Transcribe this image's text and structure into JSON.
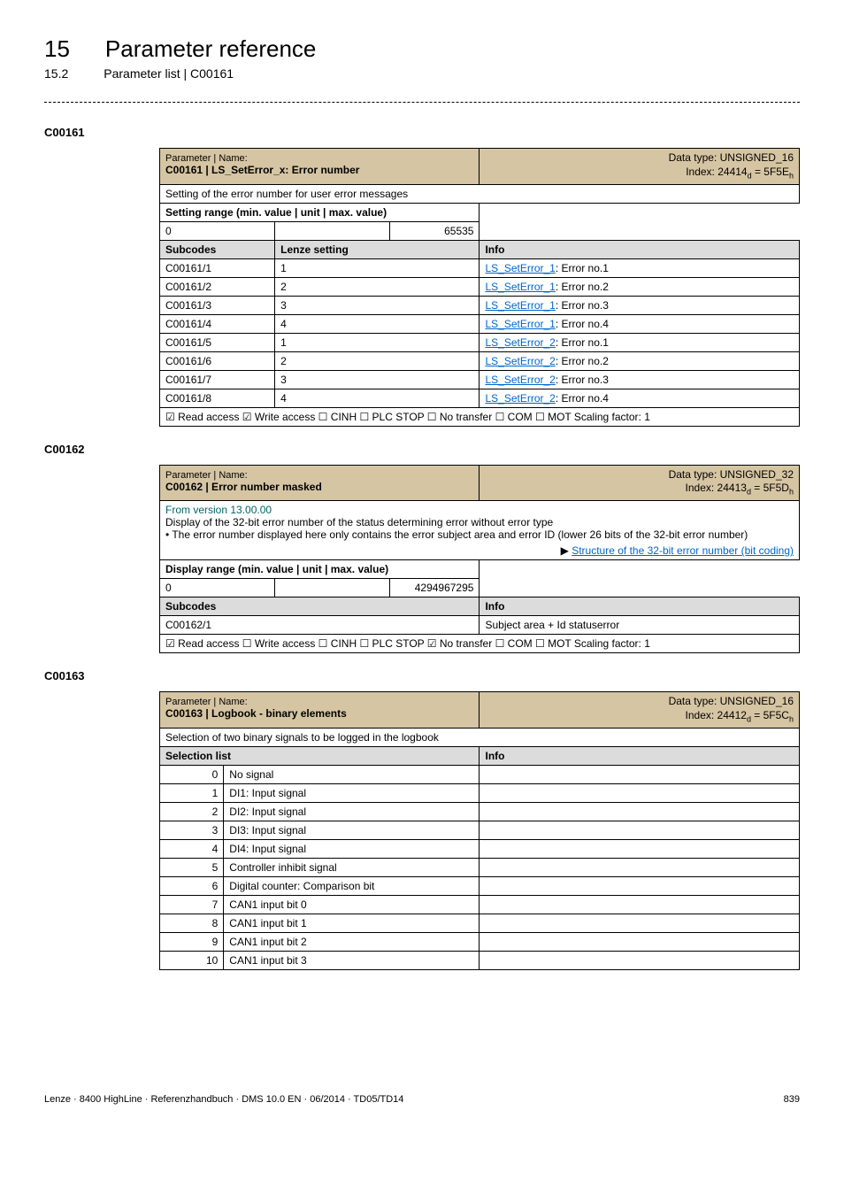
{
  "header": {
    "chapter_num": "15",
    "chapter_title": "Parameter reference",
    "section_num": "15.2",
    "section_title": "Parameter list | C00161"
  },
  "p161": {
    "code": "C00161",
    "param_label": "Parameter | Name:",
    "param_name": "C00161 | LS_SetError_x: Error number",
    "dt1": "Data type: UNSIGNED_16",
    "dt2_a": "Index: 24414",
    "dt2_b": "d",
    "dt2_c": " = 5F5E",
    "dt2_d": "h",
    "desc": "Setting of the error number for user error messages",
    "range_label": "Setting range (min. value | unit | max. value)",
    "min": "0",
    "max": "65535",
    "h_sub": "Subcodes",
    "h_lenze": "Lenze setting",
    "h_info": "Info",
    "rows": [
      {
        "sub": "C00161/1",
        "val": "1",
        "link": "LS_SetError_1",
        "rest": ": Error no.1"
      },
      {
        "sub": "C00161/2",
        "val": "2",
        "link": "LS_SetError_1",
        "rest": ": Error no.2"
      },
      {
        "sub": "C00161/3",
        "val": "3",
        "link": "LS_SetError_1",
        "rest": ": Error no.3"
      },
      {
        "sub": "C00161/4",
        "val": "4",
        "link": "LS_SetError_1",
        "rest": ": Error no.4"
      },
      {
        "sub": "C00161/5",
        "val": "1",
        "link": "LS_SetError_2",
        "rest": ": Error no.1"
      },
      {
        "sub": "C00161/6",
        "val": "2",
        "link": "LS_SetError_2",
        "rest": ": Error no.2"
      },
      {
        "sub": "C00161/7",
        "val": "3",
        "link": "LS_SetError_2",
        "rest": ": Error no.3"
      },
      {
        "sub": "C00161/8",
        "val": "4",
        "link": "LS_SetError_2",
        "rest": ": Error no.4"
      }
    ],
    "foot": "☑ Read access   ☑ Write access   ☐ CINH   ☐ PLC STOP   ☐ No transfer   ☐ COM   ☐ MOT    Scaling factor: 1"
  },
  "p162": {
    "code": "C00162",
    "param_label": "Parameter | Name:",
    "param_name": "C00162 | Error number masked",
    "dt1": "Data type: UNSIGNED_32",
    "dt2_a": "Index: 24413",
    "dt2_b": "d",
    "dt2_c": " = 5F5D",
    "dt2_d": "h",
    "version": "From version 13.00.00",
    "disp_line": "Display of the 32-bit error number of the status determining error without error type",
    "bullet": " • The error number displayed here only contains the error subject area and error ID (lower 26 bits of the 32-bit error number)",
    "struct_arrow": "▶ ",
    "struct_link": "Structure of the 32-bit error number (bit coding)",
    "range_label": "Display range (min. value | unit | max. value)",
    "min": "0",
    "max": "4294967295",
    "h_sub": "Subcodes",
    "h_info": "Info",
    "row_sub": "C00162/1",
    "row_info": "Subject area + Id statuserror",
    "foot": "☑ Read access   ☐ Write access   ☐ CINH   ☐ PLC STOP   ☑ No transfer   ☐ COM   ☐ MOT    Scaling factor: 1"
  },
  "p163": {
    "code": "C00163",
    "param_label": "Parameter | Name:",
    "param_name": "C00163 | Logbook - binary elements",
    "dt1": "Data type: UNSIGNED_16",
    "dt2_a": "Index: 24412",
    "dt2_b": "d",
    "dt2_c": " = 5F5C",
    "dt2_d": "h",
    "desc": "Selection of two binary signals to be logged in the logbook",
    "h_sel": "Selection list",
    "h_info": "Info",
    "rows": [
      {
        "n": "0",
        "t": "No signal"
      },
      {
        "n": "1",
        "t": "DI1: Input signal"
      },
      {
        "n": "2",
        "t": "DI2: Input signal"
      },
      {
        "n": "3",
        "t": "DI3: Input signal"
      },
      {
        "n": "4",
        "t": "DI4: Input signal"
      },
      {
        "n": "5",
        "t": "Controller inhibit signal"
      },
      {
        "n": "6",
        "t": "Digital counter: Comparison bit"
      },
      {
        "n": "7",
        "t": "CAN1 input bit 0"
      },
      {
        "n": "8",
        "t": "CAN1 input bit 1"
      },
      {
        "n": "9",
        "t": "CAN1 input bit 2"
      },
      {
        "n": "10",
        "t": "CAN1 input bit 3"
      }
    ]
  },
  "footer": {
    "left": "Lenze · 8400 HighLine · Referenzhandbuch · DMS 10.0 EN · 06/2014 · TD05/TD14",
    "right": "839"
  }
}
